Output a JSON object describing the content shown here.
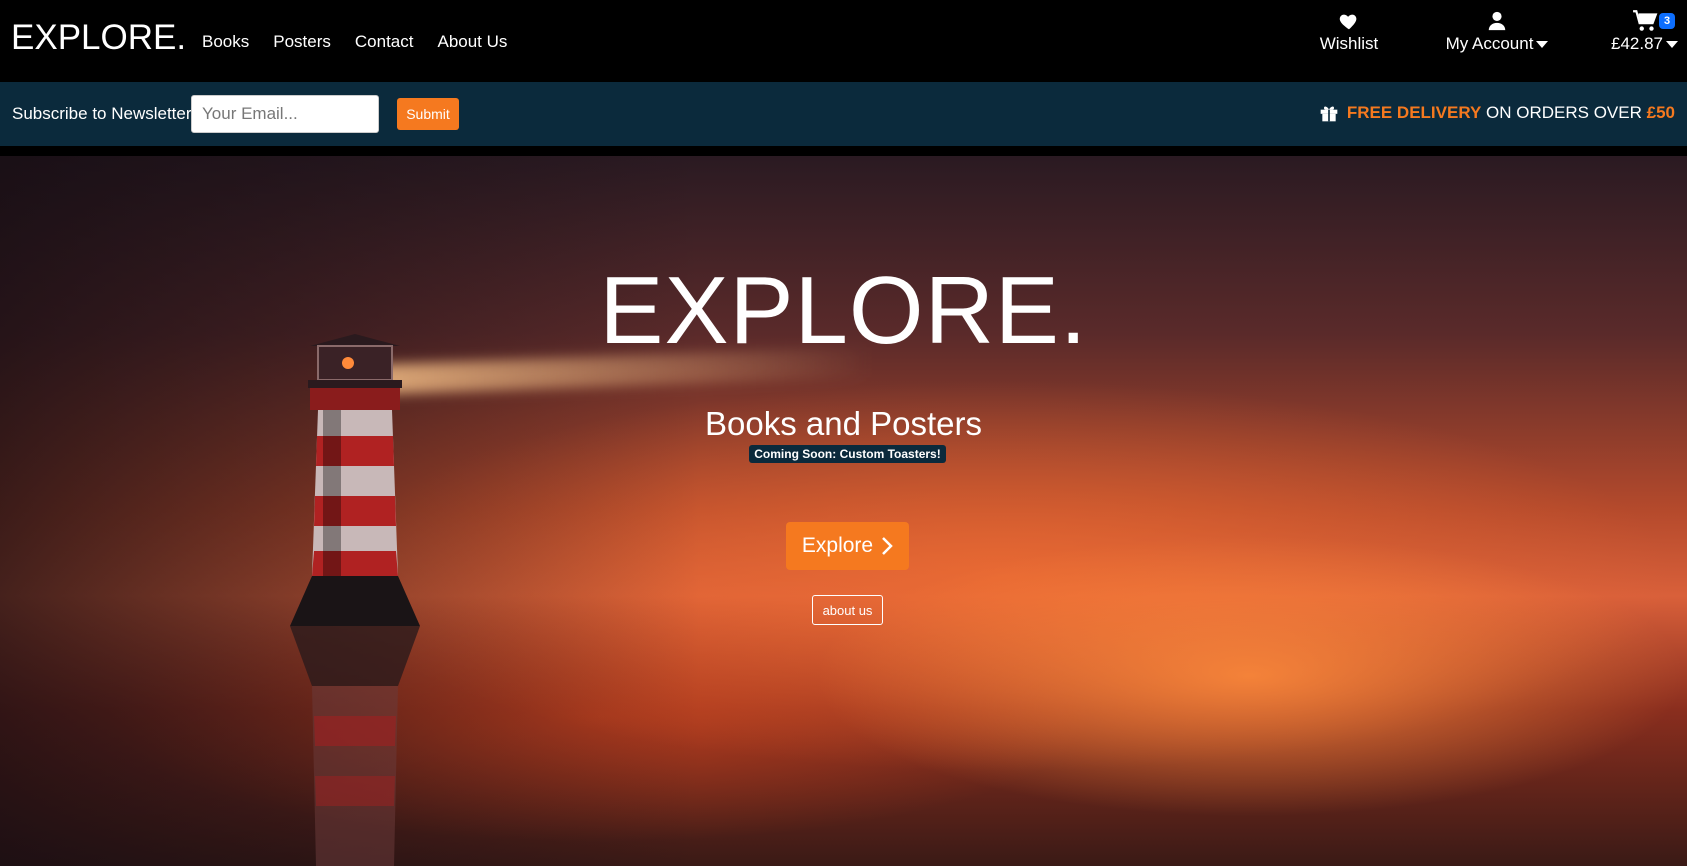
{
  "brand": "EXPLORE.",
  "nav": {
    "links": [
      "Books",
      "Posters",
      "Contact",
      "About Us"
    ],
    "wishlist_label": "Wishlist",
    "account_label": "My Account",
    "cart_total": "£42.87",
    "cart_count": "3"
  },
  "newsletter": {
    "label": "Subscribe to Newsletter",
    "email_placeholder": "Your Email...",
    "submit_label": "Submit"
  },
  "delivery": {
    "highlight": "FREE DELIVERY",
    "middle": " ON ORDERS OVER ",
    "amount": "£50"
  },
  "hero": {
    "title": "EXPLORE.",
    "subtitle": "Books and Posters",
    "tag": "Coming Soon: Custom Toasters!",
    "explore_label": "Explore",
    "about_label": "about us"
  },
  "colors": {
    "accent": "#f5791f",
    "bar_bg": "#0b2a3c",
    "badge": "#0d6efd"
  }
}
